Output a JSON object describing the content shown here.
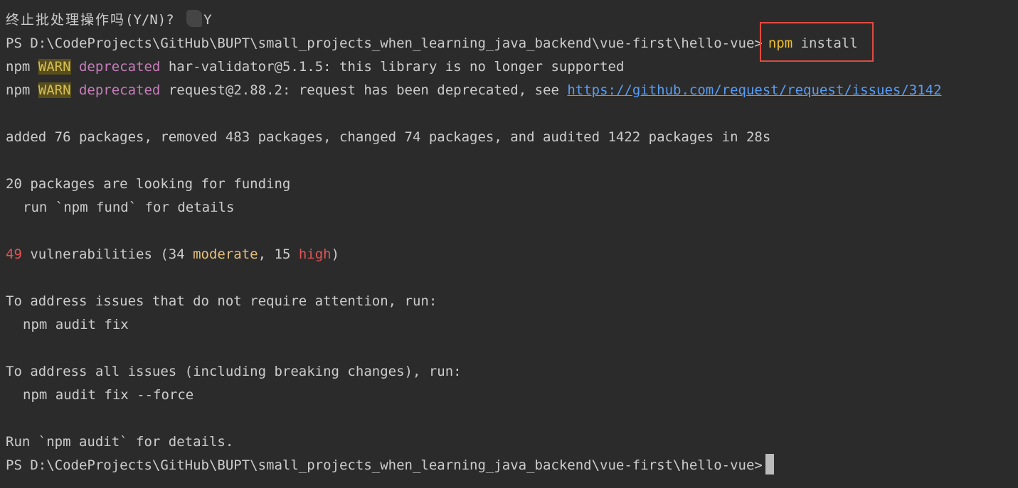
{
  "terminal": {
    "line1": {
      "prompt_cn": "终止批处理操作吗",
      "prompt_suffix": "(Y/N)? ",
      "answer": "Y"
    },
    "line2": {
      "ps_prompt": "PS D:\\CodeProjects\\GitHub\\BUPT\\small_projects_when_learning_java_backend\\vue-first\\hello-vue>",
      "cmd_npm": "npm",
      "cmd_args": " install"
    },
    "line3": {
      "npm": "npm ",
      "warn": "WARN",
      "deprecated": " deprecated",
      "message": " har-validator@5.1.5: this library is no longer supported"
    },
    "line4": {
      "npm": "npm ",
      "warn": "WARN",
      "deprecated": " deprecated",
      "message": " request@2.88.2: request has been deprecated, see ",
      "link": "https://github.com/request/request/issues/3142"
    },
    "line6": "added 76 packages, removed 483 packages, changed 74 packages, and audited 1422 packages in 28s",
    "line8": "20 packages are looking for funding",
    "line9": "run `npm fund` for details",
    "line11": {
      "count": "49",
      "text1": " vulnerabilities (34 ",
      "moderate": "moderate",
      "text2": ", 15 ",
      "high": "high",
      "text3": ")"
    },
    "line13": "To address issues that do not require attention, run:",
    "line14": "npm audit fix",
    "line16": "To address all issues (including breaking changes), run:",
    "line17": "npm audit fix --force",
    "line19": "Run `npm audit` for details.",
    "line20": {
      "ps_prompt": "PS D:\\CodeProjects\\GitHub\\BUPT\\small_projects_when_learning_java_backend\\vue-first\\hello-vue>"
    }
  },
  "colors": {
    "background": "#2b2b2b",
    "text": "#cccccc",
    "warn_bg": "#594f1c",
    "deprecated": "#c77dbb",
    "moderate": "#e5c07b",
    "high": "#e35454",
    "link": "#589df6",
    "highlight_box": "#e04b3f"
  }
}
